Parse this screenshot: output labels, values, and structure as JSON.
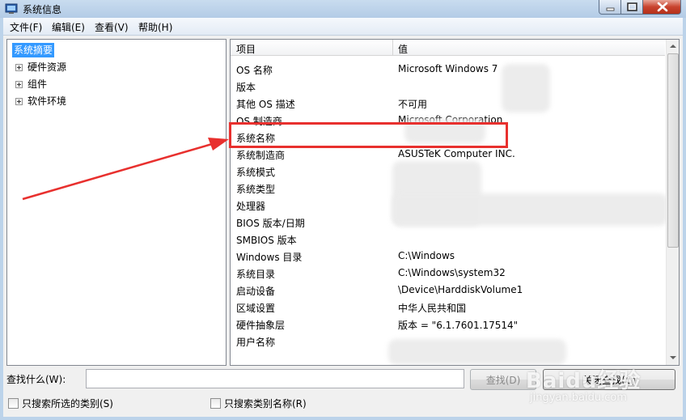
{
  "window": {
    "title": "系统信息",
    "icon": "system-info-icon"
  },
  "menu": {
    "items": [
      "文件(F)",
      "编辑(E)",
      "查看(V)",
      "帮助(H)"
    ]
  },
  "tree": {
    "root": "系统摘要",
    "children": [
      "硬件资源",
      "组件",
      "软件环境"
    ]
  },
  "list": {
    "columns": [
      "项目",
      "值"
    ],
    "rows": [
      {
        "item": "OS 名称",
        "value": "Microsoft Windows 7"
      },
      {
        "item": "版本",
        "value": ""
      },
      {
        "item": "其他 OS 描述",
        "value": "不可用"
      },
      {
        "item": "OS 制造商",
        "value": "Microsoft Corporation"
      },
      {
        "item": "系统名称",
        "value": ""
      },
      {
        "item": "系统制造商",
        "value": "ASUSTeK Computer INC."
      },
      {
        "item": "系统模式",
        "value": ""
      },
      {
        "item": "系统类型",
        "value": ""
      },
      {
        "item": "处理器",
        "value": ""
      },
      {
        "item": "BIOS 版本/日期",
        "value": ""
      },
      {
        "item": "SMBIOS 版本",
        "value": ""
      },
      {
        "item": "Windows 目录",
        "value": "C:\\Windows"
      },
      {
        "item": "系统目录",
        "value": "C:\\Windows\\system32"
      },
      {
        "item": "启动设备",
        "value": "\\Device\\HarddiskVolume1"
      },
      {
        "item": "区域设置",
        "value": "中华人民共和国"
      },
      {
        "item": "硬件抽象层",
        "value": "版本 = \"6.1.7601.17514\""
      },
      {
        "item": "用户名称",
        "value": ""
      }
    ]
  },
  "search": {
    "label": "查找什么(W):",
    "value": "",
    "find_button": "查找(D)",
    "close_button": "关闭查找(C)",
    "checkbox_selected_category": "只搜索所选的类别(S)",
    "checkbox_category_names": "只搜索类别名称(R)"
  },
  "watermark": {
    "brand": "Baidu经验",
    "url": "jingyan.baidu.com"
  },
  "colors": {
    "highlight_red": "#e8302e",
    "selection_blue": "#3399ff"
  }
}
